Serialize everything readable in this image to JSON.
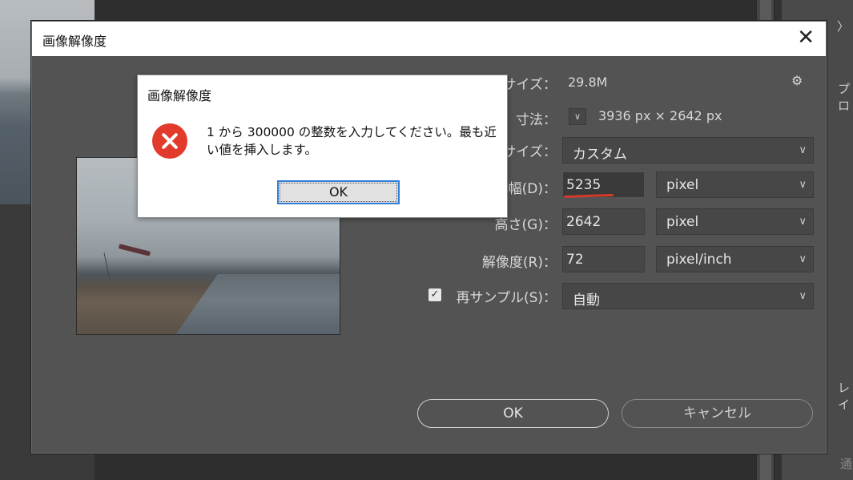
{
  "dialog": {
    "title": "画像解像度",
    "close_glyph": "✕",
    "gear_glyph": "⚙",
    "image_size_label": "画像サイズ：",
    "image_size_value": "29.8M",
    "dimensions_label": "寸法：",
    "dimensions_toggle": "∨",
    "dimensions_value": "3936 px × 2642 px",
    "fit_label": "サイズ：",
    "fit_value": "カスタム",
    "width_label": "幅(D)：",
    "width_value": "5235",
    "width_unit": "pixel",
    "height_label": "高さ(G)：",
    "height_value": "2642",
    "height_unit": "pixel",
    "resolution_label": "解像度(R)：",
    "resolution_value": "72",
    "resolution_unit": "pixel/inch",
    "resample_label": "再サンプル(S)：",
    "resample_checked": true,
    "resample_value": "自動",
    "ok_label": "OK",
    "cancel_label": "キャンセル"
  },
  "alert": {
    "title": "画像解像度",
    "message": "1 から 300000 の整数を入力してください。最も近い値を挿入します。",
    "ok_label": "OK"
  },
  "right_panel": {
    "item1": "〉",
    "item2": "プロ",
    "item3": "レイ",
    "item4": "通"
  },
  "colors": {
    "dialog_bg": "#535353",
    "alert_bg": "#ffffff",
    "error_red": "#e23b2b",
    "underline_red": "#d23a2b"
  }
}
